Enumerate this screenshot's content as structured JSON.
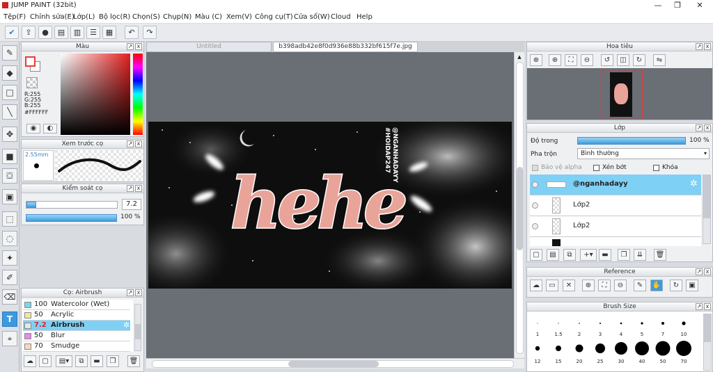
{
  "title": "JUMP PAINT (32bit)",
  "window_controls": {
    "minimize": "—",
    "maximize": "❐",
    "close": "✕"
  },
  "menu": [
    "Tệp(F)",
    "Chỉnh sửa(E)",
    "Lớp(L)",
    "Bộ lọc(R)",
    "Chọn(S)",
    "Chụp(N)",
    "Màu (C)",
    "Xem(V)",
    "Công cụ(T)",
    "Cửa sổ(W)",
    "Cloud",
    "Help"
  ],
  "color_panel": {
    "title": "Màu",
    "r": "R:255",
    "g": "G:255",
    "b": "B:255",
    "hex": "#FFFFFF"
  },
  "preview_panel": {
    "title": "Xem trước cọ",
    "size": "2.55mm"
  },
  "brush_control": {
    "title": "Kiểm soát cọ",
    "size_value": "7.2",
    "opacity_value": "100 %"
  },
  "brush_list": {
    "title": "Cọ: Airbrush",
    "items": [
      {
        "value": "100",
        "name": "Watercolor (Wet)",
        "color": "#7fd3ea",
        "selected": false
      },
      {
        "value": "50",
        "name": "Acrylic",
        "color": "#f3e99a",
        "selected": false
      },
      {
        "value": "7.2",
        "name": "Airbrush",
        "color": "#e7e7e7",
        "selected": true
      },
      {
        "value": "50",
        "name": "Blur",
        "color": "#e68ae8",
        "selected": false
      },
      {
        "value": "70",
        "name": "Smudge",
        "color": "#f5d9c0",
        "selected": false
      }
    ]
  },
  "tabs": [
    "Untitled",
    "b398adb42e8f0d936e88b332bf615f7e.jpg"
  ],
  "canvas_text": {
    "main": "hehe",
    "handle1": "@NGANHADAYY",
    "handle2": "#HOIDAP247"
  },
  "navigator": {
    "title": "Hoa tiêu"
  },
  "layer_panel": {
    "title": "Lớp",
    "opacity_label": "Độ trong",
    "opacity_value": "100 %",
    "blend_label": "Pha trộn",
    "blend_value": "Bình thường",
    "protect_alpha": "Bảo vệ alpha",
    "clipping": "Xén bớt",
    "lock": "Khóa",
    "layers": [
      {
        "name": "@nganhadayy",
        "selected": true
      },
      {
        "name": "Lớp2",
        "selected": false
      },
      {
        "name": "Lớp2",
        "selected": false
      }
    ]
  },
  "reference": {
    "title": "Reference"
  },
  "brush_size": {
    "title": "Brush Size",
    "row1": [
      "1",
      "1.5",
      "2",
      "3",
      "4",
      "5",
      "7",
      "10"
    ],
    "row2": [
      "12",
      "15",
      "20",
      "25",
      "30",
      "40",
      "50",
      "70"
    ]
  },
  "colors": {
    "accent": "#3b9be0",
    "selected_row": "#7fd0f5",
    "canvas_bg": "#6a6e75",
    "highlight_red": "#e83b3b"
  }
}
